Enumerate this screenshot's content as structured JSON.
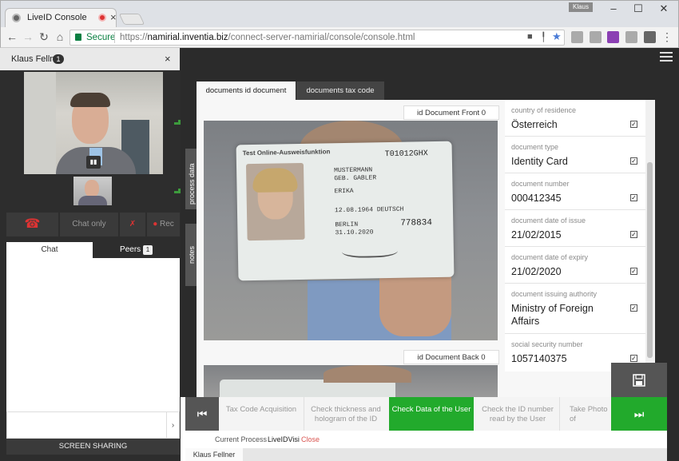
{
  "browser": {
    "tab_title": "LiveID Console",
    "user_badge": "Klaus",
    "address": {
      "secure_label": "Secure",
      "url_prefix": "https://",
      "url_host": "namirial.inventia.biz",
      "url_path": "/connect-server-namirial/console/console.html"
    },
    "window_controls": {
      "minimize": "–",
      "maximize": "☐",
      "close": "✕"
    }
  },
  "app": {
    "peer_tab": {
      "name": "Klaus Fellner",
      "count": "1",
      "close": "×"
    },
    "controls": {
      "chat_only": "Chat only",
      "rec": "Rec"
    },
    "chat_tabs": {
      "chat": "Chat",
      "peers": "Peers",
      "peers_count": "1"
    },
    "screen_sharing": "SCREEN SHARING",
    "side_tabs": {
      "process_data": "process data",
      "notes": "notes"
    },
    "doc_tabs": [
      {
        "label": "documents id document",
        "active": true
      },
      {
        "label": "documents tax code",
        "active": false
      }
    ],
    "image_labels": {
      "front": "id Document Front 0",
      "back": "id Document Back 0"
    },
    "id_card": {
      "heading": "Test Online-Ausweisfunktion",
      "number": "T01012GHX",
      "surname": "MUSTERMANN",
      "birth_name": "GEB. GABLER",
      "given_name": "ERIKA",
      "dob": "12.08.1964",
      "nationality": "DEUTSCH",
      "place": "BERLIN",
      "expiry": "31.10.2020",
      "can": "778834"
    },
    "fields": [
      {
        "label": "country of residence",
        "value": "Österreich",
        "checked": true
      },
      {
        "label": "document type",
        "value": "Identity Card",
        "checked": true
      },
      {
        "label": "document number",
        "value": "000412345",
        "checked": true
      },
      {
        "label": "document date of issue",
        "value": "21/02/2015",
        "checked": true
      },
      {
        "label": "document date of expiry",
        "value": "21/02/2020",
        "checked": true
      },
      {
        "label": "document issuing authority",
        "value": "Ministry of Foreign Affairs",
        "checked": true
      },
      {
        "label": "social security number",
        "value": "1057140375",
        "checked": true
      }
    ],
    "steps": [
      {
        "label": "Tax Code Acquisition",
        "active": false
      },
      {
        "label": "Check thickness and hologram of the ID",
        "active": false
      },
      {
        "label": "Check Data of the User",
        "active": true
      },
      {
        "label": "Check the ID number read by the User",
        "active": false
      },
      {
        "label": "Take Photo of",
        "active": false
      }
    ],
    "process": {
      "label": "Current Process",
      "name": "LiveIDVisi",
      "close": "Close"
    },
    "bottom_tab": "Klaus Fellner",
    "colors": {
      "accent_green": "#22aa2c",
      "dark": "#2b2b2b",
      "close_red": "#d9534f"
    }
  }
}
